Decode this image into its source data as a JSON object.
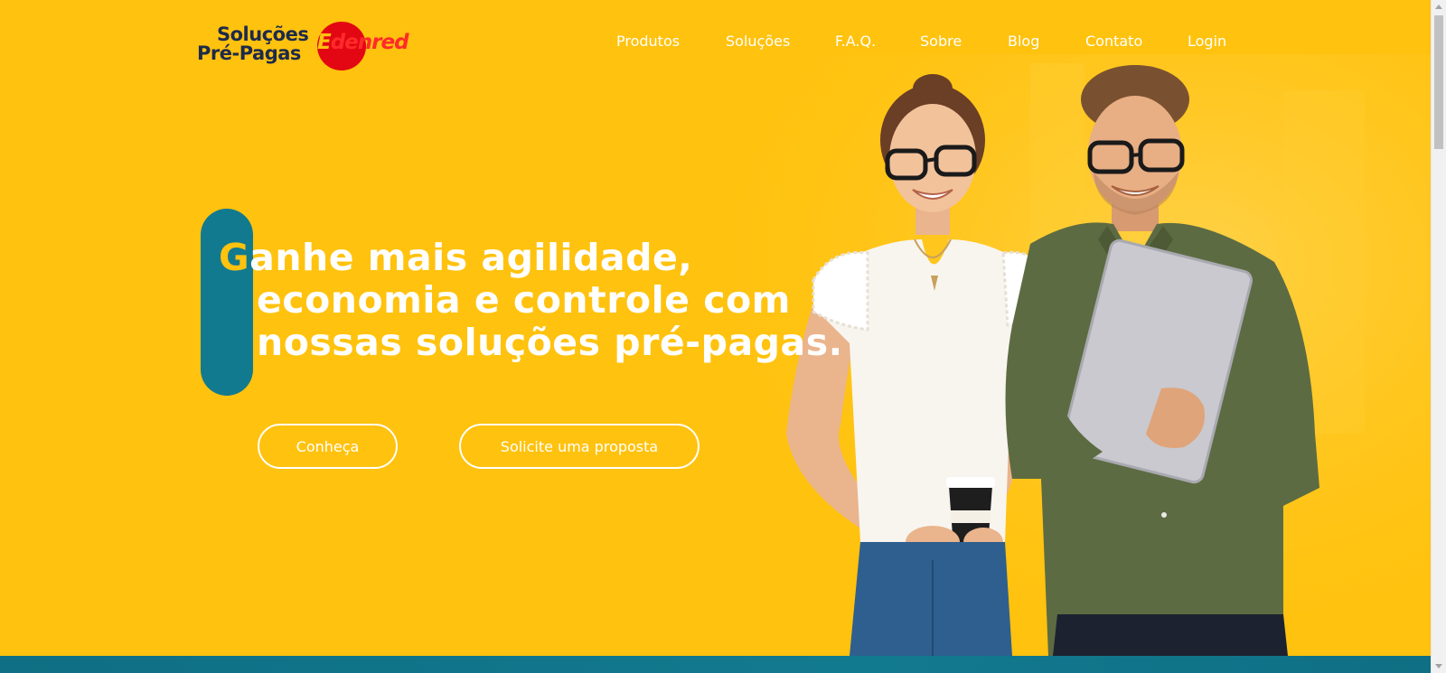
{
  "brand": {
    "product_line1": "Soluções",
    "product_line2": "Pré-Pagas",
    "company_first_letter": "E",
    "company_rest": "denred"
  },
  "nav": {
    "items": [
      "Produtos",
      "Soluções",
      "F.A.Q.",
      "Sobre",
      "Blog",
      "Contato",
      "Login"
    ]
  },
  "hero": {
    "title_cap": "G",
    "title_line1_rest": "anhe mais agilidade,",
    "title_line2": "economia e controle com",
    "title_line3": "nossas soluções pré-pagas.",
    "buttons": {
      "primary": "Conheça",
      "secondary": "Solicite uma proposta"
    }
  },
  "colors": {
    "background": "#ffc20e",
    "accent_teal": "#127a8f",
    "brand_red": "#e30613",
    "text_light": "#ffffff",
    "logo_dark": "#1d2a4a"
  }
}
